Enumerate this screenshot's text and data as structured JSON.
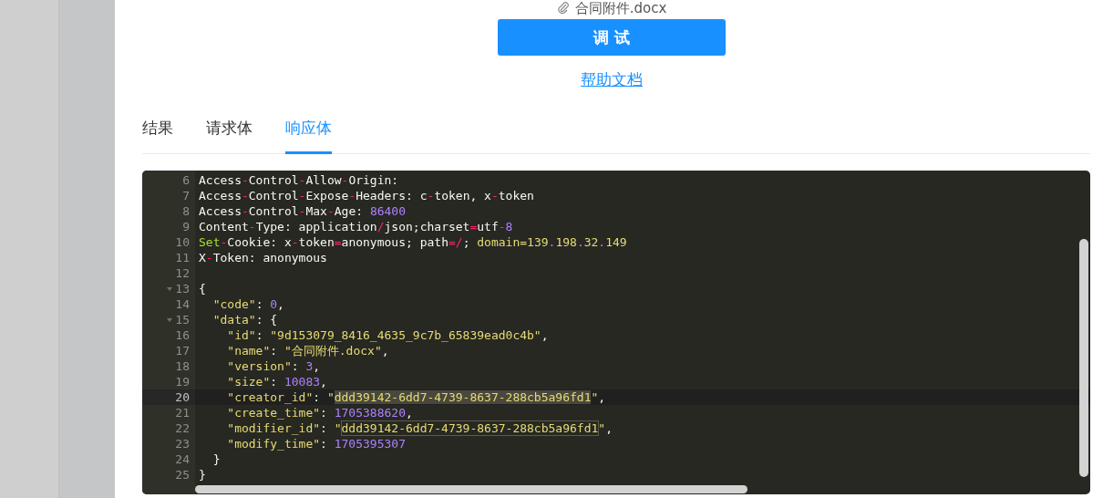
{
  "attachment": {
    "file_name": "合同附件.docx"
  },
  "debug_button": "调 试",
  "help_link": "帮助文档",
  "tabs": [
    {
      "label": "结果",
      "selected": false
    },
    {
      "label": "请求体",
      "selected": false
    },
    {
      "label": "响应体",
      "selected": true
    }
  ],
  "editor": {
    "lines": [
      {
        "number": "6",
        "active": false,
        "foldable": false,
        "tokens": [
          {
            "kind": "t",
            "text": "Access"
          },
          {
            "kind": "o",
            "text": "-"
          },
          {
            "kind": "t",
            "text": "Control"
          },
          {
            "kind": "o",
            "text": "-"
          },
          {
            "kind": "t",
            "text": "Allow"
          },
          {
            "kind": "o",
            "text": "-"
          },
          {
            "kind": "t",
            "text": "Origin:"
          }
        ]
      },
      {
        "number": "7",
        "active": false,
        "foldable": false,
        "tokens": [
          {
            "kind": "t",
            "text": "Access"
          },
          {
            "kind": "o",
            "text": "-"
          },
          {
            "kind": "t",
            "text": "Control"
          },
          {
            "kind": "o",
            "text": "-"
          },
          {
            "kind": "t",
            "text": "Expose"
          },
          {
            "kind": "o",
            "text": "-"
          },
          {
            "kind": "t",
            "text": "Headers: c"
          },
          {
            "kind": "o",
            "text": "-"
          },
          {
            "kind": "t",
            "text": "token, x"
          },
          {
            "kind": "o",
            "text": "-"
          },
          {
            "kind": "t",
            "text": "token"
          }
        ]
      },
      {
        "number": "8",
        "active": false,
        "foldable": false,
        "tokens": [
          {
            "kind": "t",
            "text": "Access"
          },
          {
            "kind": "o",
            "text": "-"
          },
          {
            "kind": "t",
            "text": "Control"
          },
          {
            "kind": "o",
            "text": "-"
          },
          {
            "kind": "t",
            "text": "Max"
          },
          {
            "kind": "o",
            "text": "-"
          },
          {
            "kind": "t",
            "text": "Age: "
          },
          {
            "kind": "n",
            "text": "86400"
          }
        ]
      },
      {
        "number": "9",
        "active": false,
        "foldable": false,
        "tokens": [
          {
            "kind": "t",
            "text": "Content"
          },
          {
            "kind": "o",
            "text": "-"
          },
          {
            "kind": "t",
            "text": "Type: application"
          },
          {
            "kind": "o",
            "text": "/"
          },
          {
            "kind": "t",
            "text": "json;charset"
          },
          {
            "kind": "o",
            "text": "="
          },
          {
            "kind": "t",
            "text": "utf"
          },
          {
            "kind": "o",
            "text": "-"
          },
          {
            "kind": "n",
            "text": "8"
          }
        ]
      },
      {
        "number": "10",
        "active": false,
        "foldable": false,
        "tokens": [
          {
            "kind": "k",
            "text": "Set"
          },
          {
            "kind": "o",
            "text": "-"
          },
          {
            "kind": "t",
            "text": "Cookie: x"
          },
          {
            "kind": "o",
            "text": "-"
          },
          {
            "kind": "t",
            "text": "token"
          },
          {
            "kind": "o",
            "text": "="
          },
          {
            "kind": "t",
            "text": "anonymous; path"
          },
          {
            "kind": "o",
            "text": "=/"
          },
          {
            "kind": "t",
            "text": "; "
          },
          {
            "kind": "s",
            "text": "domain=139"
          },
          {
            "kind": "n",
            "text": "."
          },
          {
            "kind": "s",
            "text": "198"
          },
          {
            "kind": "n",
            "text": "."
          },
          {
            "kind": "s",
            "text": "32"
          },
          {
            "kind": "n",
            "text": "."
          },
          {
            "kind": "s",
            "text": "149"
          }
        ]
      },
      {
        "number": "11",
        "active": false,
        "foldable": false,
        "tokens": [
          {
            "kind": "t",
            "text": "X"
          },
          {
            "kind": "o",
            "text": "-"
          },
          {
            "kind": "t",
            "text": "Token: anonymous"
          }
        ]
      },
      {
        "number": "12",
        "active": false,
        "foldable": false
      },
      {
        "number": "13",
        "active": false,
        "foldable": true,
        "tokens": [
          {
            "kind": "t",
            "text": "{"
          }
        ]
      },
      {
        "number": "14",
        "active": false,
        "foldable": false,
        "tokens": [
          {
            "kind": "s",
            "text": "  \"code\""
          },
          {
            "kind": "t",
            "text": ": "
          },
          {
            "kind": "n",
            "text": "0"
          },
          {
            "kind": "t",
            "text": ","
          }
        ]
      },
      {
        "number": "15",
        "active": false,
        "foldable": true,
        "tokens": [
          {
            "kind": "s",
            "text": "  \"data\""
          },
          {
            "kind": "t",
            "text": ": {"
          }
        ]
      },
      {
        "number": "16",
        "active": false,
        "foldable": false,
        "tokens": [
          {
            "kind": "s",
            "text": "    \"id\""
          },
          {
            "kind": "t",
            "text": ": "
          },
          {
            "kind": "s",
            "text": "\"9d153079_8416_4635_9c7b_65839ead0c4b\""
          },
          {
            "kind": "t",
            "text": ","
          }
        ]
      },
      {
        "number": "17",
        "active": false,
        "foldable": false,
        "tokens": [
          {
            "kind": "s",
            "text": "    \"name\""
          },
          {
            "kind": "t",
            "text": ": "
          },
          {
            "kind": "s",
            "text": "\"合同附件.docx\""
          },
          {
            "kind": "t",
            "text": ","
          }
        ]
      },
      {
        "number": "18",
        "active": false,
        "foldable": false,
        "tokens": [
          {
            "kind": "s",
            "text": "    \"version\""
          },
          {
            "kind": "t",
            "text": ": "
          },
          {
            "kind": "n",
            "text": "3"
          },
          {
            "kind": "t",
            "text": ","
          }
        ]
      },
      {
        "number": "19",
        "active": false,
        "foldable": false,
        "tokens": [
          {
            "kind": "s",
            "text": "    \"size\""
          },
          {
            "kind": "t",
            "text": ": "
          },
          {
            "kind": "n",
            "text": "10083"
          },
          {
            "kind": "t",
            "text": ","
          }
        ]
      },
      {
        "number": "20",
        "active": true,
        "foldable": false,
        "tokens": [
          {
            "kind": "s",
            "text": "    \"creator_id\""
          },
          {
            "kind": "t",
            "text": ": "
          },
          {
            "kind": "s",
            "text": "\""
          },
          {
            "kind": "sel",
            "text": "ddd39142-6dd7-4739-8637-288cb5a96fd1"
          },
          {
            "kind": "s",
            "text": "\""
          },
          {
            "kind": "t",
            "text": ","
          }
        ]
      },
      {
        "number": "21",
        "active": false,
        "foldable": false,
        "tokens": [
          {
            "kind": "s",
            "text": "    \"create_time\""
          },
          {
            "kind": "t",
            "text": ": "
          },
          {
            "kind": "n",
            "text": "1705388620"
          },
          {
            "kind": "t",
            "text": ","
          }
        ]
      },
      {
        "number": "22",
        "active": false,
        "foldable": false,
        "tokens": [
          {
            "kind": "s",
            "text": "    \"modifier_id\""
          },
          {
            "kind": "t",
            "text": ": "
          },
          {
            "kind": "s",
            "text": "\""
          },
          {
            "kind": "match",
            "text": "ddd39142-6dd7-4739-8637-288cb5a96fd1"
          },
          {
            "kind": "s",
            "text": "\""
          },
          {
            "kind": "t",
            "text": ","
          }
        ]
      },
      {
        "number": "23",
        "active": false,
        "foldable": false,
        "tokens": [
          {
            "kind": "s",
            "text": "    \"modify_time\""
          },
          {
            "kind": "t",
            "text": ": "
          },
          {
            "kind": "n",
            "text": "1705395307"
          }
        ]
      },
      {
        "number": "24",
        "active": false,
        "foldable": false,
        "tokens": [
          {
            "kind": "t",
            "text": "  }"
          }
        ]
      },
      {
        "number": "25",
        "active": false,
        "foldable": false,
        "tokens": [
          {
            "kind": "t",
            "text": "}"
          }
        ]
      }
    ]
  }
}
